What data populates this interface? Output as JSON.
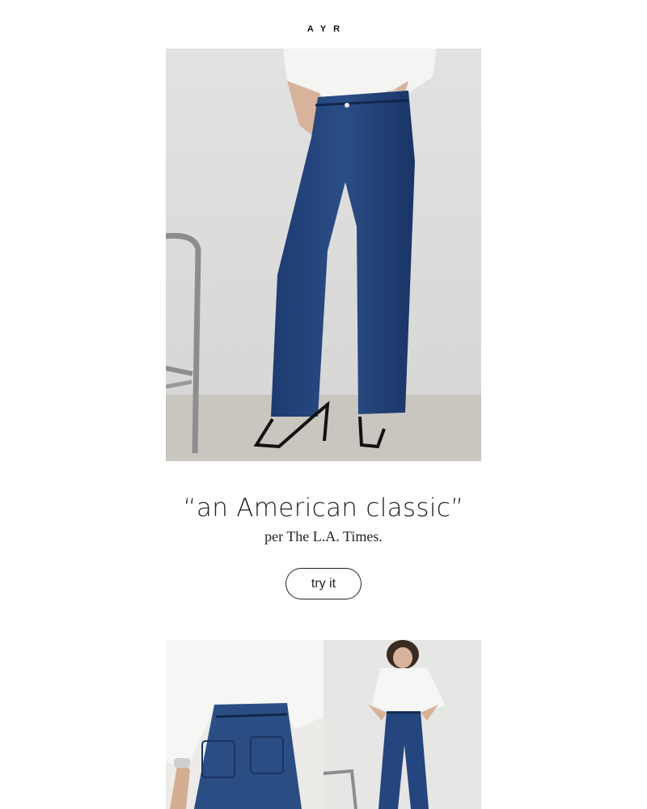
{
  "brand": {
    "logo_text": "AYR"
  },
  "hero": {
    "image_alt": "woman wearing wide-leg dark denim jeans with white shirt and strappy heels"
  },
  "headline": {
    "quote": "“an American classic”",
    "attribution": "per The L.A. Times."
  },
  "cta": {
    "label": "try it"
  },
  "gallery": [
    {
      "image_alt": "back view of jeans with white shirt"
    },
    {
      "image_alt": "front view of woman in white shirt and dark jeans"
    }
  ],
  "colors": {
    "denim": "#22427a",
    "background": "#ffffff",
    "text": "#222222"
  }
}
